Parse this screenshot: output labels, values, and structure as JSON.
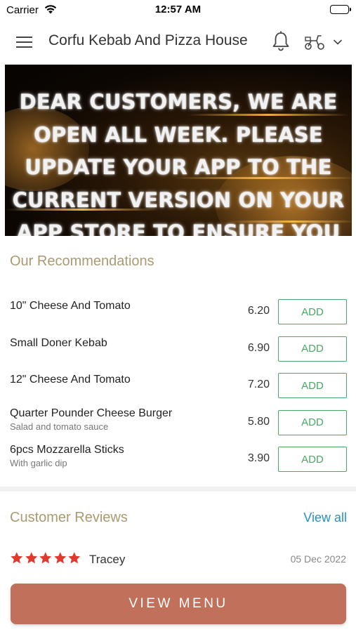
{
  "status_bar": {
    "carrier": "Carrier",
    "time": "12:57 AM"
  },
  "header": {
    "title": "Corfu Kebab And Pizza House",
    "icons": [
      "hamburger-menu-icon",
      "bell-icon",
      "scooter-icon",
      "chevron-down-icon"
    ]
  },
  "banner": {
    "lines": [
      "DEAR CUSTOMERS, WE ARE",
      "OPEN ALL WEEK. PLEASE",
      "UPDATE YOUR APP TO THE",
      "CURRENT VERSION ON YOUR",
      "APP STORE TO ENSURE YOU"
    ]
  },
  "recommendations": {
    "title": "Our Recommendations",
    "items": [
      {
        "name": "10\" Cheese And Tomato",
        "description": "",
        "price": "6.20",
        "button": "ADD"
      },
      {
        "name": "Small Doner Kebab",
        "description": "",
        "price": "6.90",
        "button": "ADD"
      },
      {
        "name": "12\" Cheese And Tomato",
        "description": "",
        "price": "7.20",
        "button": "ADD"
      },
      {
        "name": "Quarter Pounder Cheese Burger",
        "description": "Salad and tomato sauce",
        "price": "5.80",
        "button": "ADD"
      },
      {
        "name": "6pcs Mozzarella Sticks",
        "description": "With garlic dip",
        "price": "3.90",
        "button": "ADD"
      }
    ]
  },
  "reviews": {
    "title": "Customer Reviews",
    "view_all": "View all",
    "items": [
      {
        "rating": 5,
        "name": "Tracey",
        "date": "05 Dec 2022"
      }
    ]
  },
  "footer": {
    "button": "VIEW MENU"
  },
  "colors": {
    "accent_gold": "#a99a72",
    "add_green": "#4aa864",
    "link_blue": "#2a8fc9",
    "menu_button": "#c0705b",
    "star_red": "#e03a2f"
  }
}
